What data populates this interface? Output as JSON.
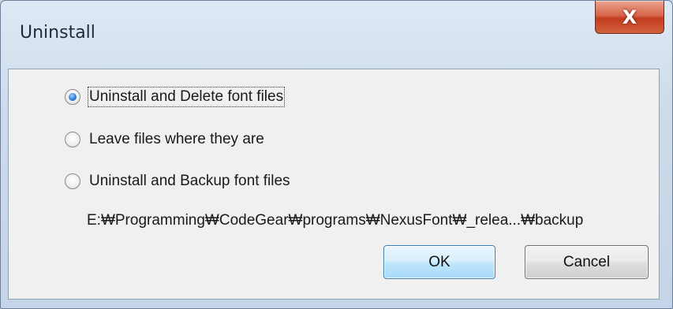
{
  "window": {
    "title": "Uninstall",
    "close_glyph": "X"
  },
  "options": {
    "delete": {
      "label": "Uninstall and Delete font files",
      "checked": true
    },
    "leave": {
      "label": "Leave files where they are",
      "checked": false
    },
    "backup": {
      "label": "Uninstall and Backup font files",
      "checked": false
    }
  },
  "backup_path": "E:₩Programming₩CodeGear₩programs₩NexusFont₩_relea...₩backup",
  "buttons": {
    "ok_label": "OK",
    "cancel_label": "Cancel"
  },
  "colors": {
    "close_button": "#c94a2c",
    "ok_button_border": "#3c7fb1",
    "radio_selected": "#2f7fd7"
  },
  "icons": {
    "close": "close-icon"
  }
}
